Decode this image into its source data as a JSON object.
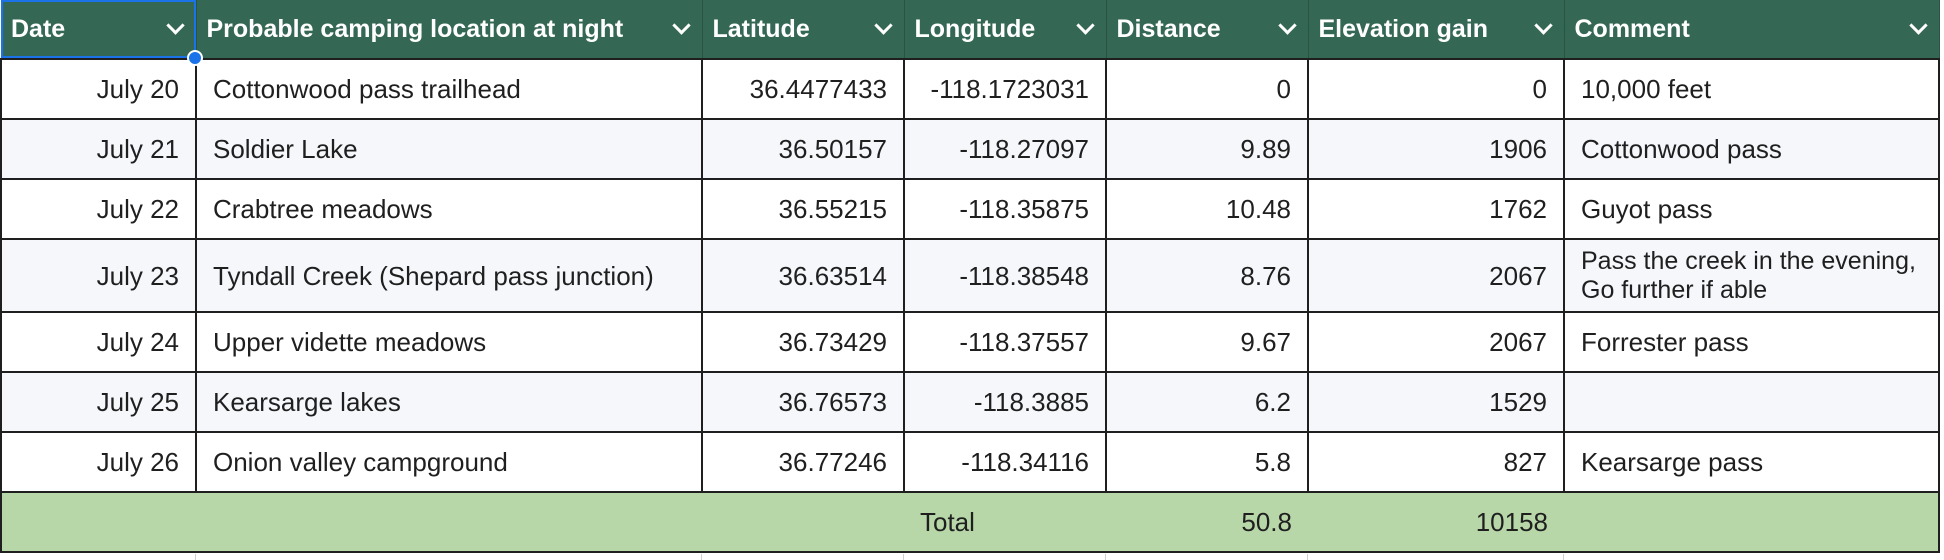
{
  "columns": [
    {
      "key": "date",
      "label": "Date"
    },
    {
      "key": "location",
      "label": "Probable camping location at night"
    },
    {
      "key": "latitude",
      "label": "Latitude"
    },
    {
      "key": "longitude",
      "label": "Longitude"
    },
    {
      "key": "distance",
      "label": "Distance"
    },
    {
      "key": "elevation",
      "label": "Elevation gain"
    },
    {
      "key": "comment",
      "label": "Comment"
    }
  ],
  "rows": [
    {
      "date": "July 20",
      "location": "Cottonwood pass trailhead",
      "latitude": "36.4477433",
      "longitude": "-118.1723031",
      "distance": "0",
      "elevation": "0",
      "comment": "10,000 feet"
    },
    {
      "date": "July 21",
      "location": "Soldier Lake",
      "latitude": "36.50157",
      "longitude": "-118.27097",
      "distance": "9.89",
      "elevation": "1906",
      "comment": "Cottonwood pass"
    },
    {
      "date": "July 22",
      "location": "Crabtree meadows",
      "latitude": "36.55215",
      "longitude": "-118.35875",
      "distance": "10.48",
      "elevation": "1762",
      "comment": "Guyot pass"
    },
    {
      "date": "July 23",
      "location": "Tyndall Creek (Shepard pass junction)",
      "latitude": "36.63514",
      "longitude": "-118.38548",
      "distance": "8.76",
      "elevation": "2067",
      "comment": "Pass the creek in the evening, Go further if able"
    },
    {
      "date": "July 24",
      "location": "Upper vidette meadows",
      "latitude": "36.73429",
      "longitude": "-118.37557",
      "distance": "9.67",
      "elevation": "2067",
      "comment": "Forrester pass"
    },
    {
      "date": "July 25",
      "location": "Kearsarge lakes",
      "latitude": "36.76573",
      "longitude": "-118.3885",
      "distance": "6.2",
      "elevation": "1529",
      "comment": ""
    },
    {
      "date": "July 26",
      "location": "Onion valley campground",
      "latitude": "36.77246",
      "longitude": "-118.34116",
      "distance": "5.8",
      "elevation": "827",
      "comment": "Kearsarge pass"
    }
  ],
  "total": {
    "label": "Total",
    "distance": "50.8",
    "elevation": "10158"
  },
  "icons": {
    "filter": "chevron-down-icon"
  },
  "colors": {
    "header_bg": "#356854",
    "header_text": "#ffffff",
    "total_bg": "#b7d7a8",
    "alt_row_bg": "#f5f7fb",
    "selection": "#1a73e8"
  }
}
